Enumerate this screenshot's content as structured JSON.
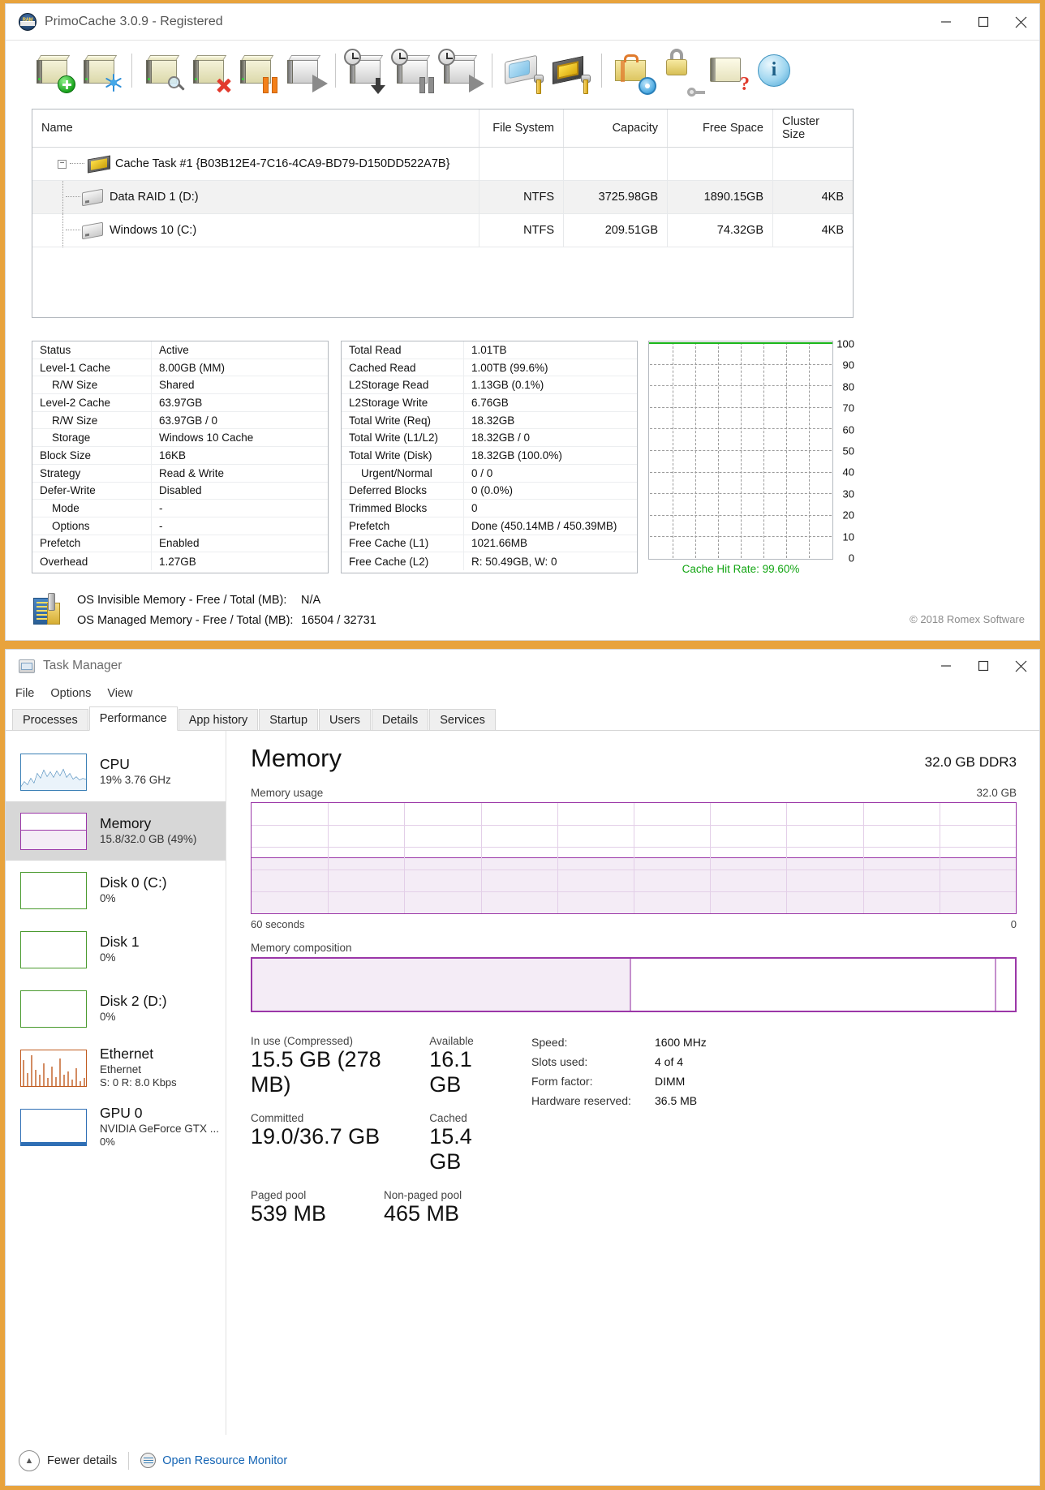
{
  "primocache": {
    "title": "PrimoCache 3.0.9 - Registered",
    "window_buttons": [
      "minimize",
      "maximize",
      "close"
    ],
    "toolbar": [
      {
        "name": "create-cache-task-icon",
        "tooltip": "Create Cache Task"
      },
      {
        "name": "defrag-cache-icon",
        "tooltip": "Defragment"
      },
      {
        "name": "view-cache-task-icon",
        "tooltip": "View Task"
      },
      {
        "name": "delete-cache-task-icon",
        "tooltip": "Delete Task"
      },
      {
        "name": "pause-cache-task-icon",
        "tooltip": "Pause Task"
      },
      {
        "name": "resume-cache-task-icon",
        "tooltip": "Resume Task"
      },
      {
        "name": "schedule-flush-icon",
        "tooltip": "Scheduled Flush"
      },
      {
        "name": "schedule-pause-icon",
        "tooltip": "Scheduled Pause"
      },
      {
        "name": "schedule-resume-icon",
        "tooltip": "Scheduled Resume"
      },
      {
        "name": "disk-tools-icon",
        "tooltip": "Disk Tools"
      },
      {
        "name": "memory-tools-icon",
        "tooltip": "Memory Tools"
      },
      {
        "name": "options-icon",
        "tooltip": "Options"
      },
      {
        "name": "license-icon",
        "tooltip": "License"
      },
      {
        "name": "help-icon",
        "tooltip": "Help"
      },
      {
        "name": "about-icon",
        "tooltip": "About"
      }
    ],
    "table": {
      "columns": [
        "Name",
        "File System",
        "Capacity",
        "Free Space",
        "Cluster Size"
      ],
      "task_row": "Cache Task #1 {B03B12E4-7C16-4CA9-BD79-D150DD522A7B}",
      "rows": [
        {
          "name": "Data RAID 1 (D:)",
          "fs": "NTFS",
          "capacity": "3725.98GB",
          "free": "1890.15GB",
          "cluster": "4KB"
        },
        {
          "name": "Windows 10 (C:)",
          "fs": "NTFS",
          "capacity": "209.51GB",
          "free": "74.32GB",
          "cluster": "4KB"
        }
      ]
    },
    "stats_left": [
      {
        "key": "Status",
        "value": "Active",
        "indent": false
      },
      {
        "key": "Level-1 Cache",
        "value": "8.00GB (MM)",
        "indent": false
      },
      {
        "key": "R/W Size",
        "value": "Shared",
        "indent": true
      },
      {
        "key": "Level-2 Cache",
        "value": "63.97GB",
        "indent": false
      },
      {
        "key": "R/W Size",
        "value": "63.97GB / 0",
        "indent": true
      },
      {
        "key": "Storage",
        "value": "Windows 10 Cache",
        "indent": true
      },
      {
        "key": "Block Size",
        "value": "16KB",
        "indent": false
      },
      {
        "key": "Strategy",
        "value": "Read & Write",
        "indent": false
      },
      {
        "key": "Defer-Write",
        "value": "Disabled",
        "indent": false
      },
      {
        "key": "Mode",
        "value": "-",
        "indent": true
      },
      {
        "key": "Options",
        "value": "-",
        "indent": true
      },
      {
        "key": "Prefetch",
        "value": "Enabled",
        "indent": false
      },
      {
        "key": "Overhead",
        "value": "1.27GB",
        "indent": false
      }
    ],
    "stats_mid": [
      {
        "key": "Total Read",
        "value": "1.01TB",
        "indent": false
      },
      {
        "key": "Cached Read",
        "value": "1.00TB (99.6%)",
        "indent": false
      },
      {
        "key": "L2Storage Read",
        "value": "1.13GB (0.1%)",
        "indent": false
      },
      {
        "key": "L2Storage Write",
        "value": "6.76GB",
        "indent": false
      },
      {
        "key": "Total Write (Req)",
        "value": "18.32GB",
        "indent": false
      },
      {
        "key": "Total Write (L1/L2)",
        "value": "18.32GB / 0",
        "indent": false
      },
      {
        "key": "Total Write (Disk)",
        "value": "18.32GB (100.0%)",
        "indent": false
      },
      {
        "key": "Urgent/Normal",
        "value": "0 / 0",
        "indent": true
      },
      {
        "key": "Deferred Blocks",
        "value": "0 (0.0%)",
        "indent": false
      },
      {
        "key": "Trimmed Blocks",
        "value": "0",
        "indent": false
      },
      {
        "key": "Prefetch",
        "value": "Done (450.14MB / 450.39MB)",
        "indent": false
      },
      {
        "key": "Free Cache (L1)",
        "value": "1021.66MB",
        "indent": false
      },
      {
        "key": "Free Cache (L2)",
        "value": "R: 50.49GB, W: 0",
        "indent": false
      }
    ],
    "chart": {
      "caption": "Cache Hit Rate: 99.60%",
      "y_ticks": [
        "100",
        "90",
        "80",
        "70",
        "60",
        "50",
        "40",
        "30",
        "20",
        "10",
        "0"
      ],
      "series_value": 99.6,
      "series_color": "#19b519"
    },
    "footer": {
      "os_invisible_label": "OS Invisible Memory - Free / Total (MB):",
      "os_invisible_value": "N/A",
      "os_managed_label": "OS Managed Memory - Free / Total (MB):",
      "os_managed_value": "16504 / 32731",
      "copyright": "© 2018 Romex Software"
    }
  },
  "taskmanager": {
    "title": "Task Manager",
    "menu": [
      "File",
      "Options",
      "View"
    ],
    "tabs": [
      "Processes",
      "Performance",
      "App history",
      "Startup",
      "Users",
      "Details",
      "Services"
    ],
    "active_tab": "Performance",
    "sidebar": [
      {
        "name": "CPU",
        "sub": "19%  3.76 GHz",
        "sub2": "",
        "selected": false,
        "color": "#3a7fb5"
      },
      {
        "name": "Memory",
        "sub": "15.8/32.0 GB (49%)",
        "sub2": "",
        "selected": true,
        "color": "#9b37a8"
      },
      {
        "name": "Disk 0 (C:)",
        "sub": "0%",
        "sub2": "",
        "selected": false,
        "color": "#4a9a2f"
      },
      {
        "name": "Disk 1",
        "sub": "0%",
        "sub2": "",
        "selected": false,
        "color": "#4a9a2f"
      },
      {
        "name": "Disk 2 (D:)",
        "sub": "0%",
        "sub2": "",
        "selected": false,
        "color": "#4a9a2f"
      },
      {
        "name": "Ethernet",
        "sub": "Ethernet",
        "sub2": "S: 0 R: 8.0 Kbps",
        "selected": false,
        "color": "#c05a1e"
      },
      {
        "name": "GPU 0",
        "sub": "NVIDIA GeForce GTX ...",
        "sub2": "0%",
        "selected": false,
        "color": "#2f6fb5"
      }
    ],
    "main": {
      "title": "Memory",
      "subtitle": "32.0 GB DDR3",
      "usage_label": "Memory usage",
      "usage_max": "32.0 GB",
      "time_label": "60 seconds",
      "time_min": "0",
      "composition_label": "Memory composition",
      "stats": [
        {
          "label": "In use (Compressed)",
          "value": "15.5 GB (278 MB)"
        },
        {
          "label": "Available",
          "value": "16.1 GB"
        },
        {
          "label": "Committed",
          "value": "19.0/36.7 GB"
        },
        {
          "label": "Cached",
          "value": "15.4 GB"
        },
        {
          "label": "Paged pool",
          "value": "539 MB"
        },
        {
          "label": "Non-paged pool",
          "value": "465 MB"
        }
      ],
      "details": [
        {
          "key": "Speed:",
          "value": "1600 MHz"
        },
        {
          "key": "Slots used:",
          "value": "4 of 4"
        },
        {
          "key": "Form factor:",
          "value": "DIMM"
        },
        {
          "key": "Hardware reserved:",
          "value": "36.5 MB"
        }
      ]
    },
    "footer": {
      "fewer_details": "Fewer details",
      "resource_monitor": "Open Resource Monitor"
    }
  },
  "chart_data": {
    "type": "line",
    "title": "Cache Hit Rate",
    "x": [
      0,
      1,
      2,
      3,
      4,
      5,
      6,
      7,
      8,
      9,
      10
    ],
    "series": [
      {
        "name": "Cache Hit Rate",
        "values": [
          99.6,
          99.6,
          99.6,
          99.6,
          99.6,
          99.6,
          99.6,
          99.6,
          99.6,
          99.6,
          99.6
        ],
        "color": "#19b519"
      }
    ],
    "ylabel": "",
    "xlabel": "",
    "ylim": [
      0,
      100
    ],
    "yticks": [
      0,
      10,
      20,
      30,
      40,
      50,
      60,
      70,
      80,
      90,
      100
    ],
    "grid": true,
    "legend": "none",
    "annotation": "Cache Hit Rate: 99.60%"
  }
}
